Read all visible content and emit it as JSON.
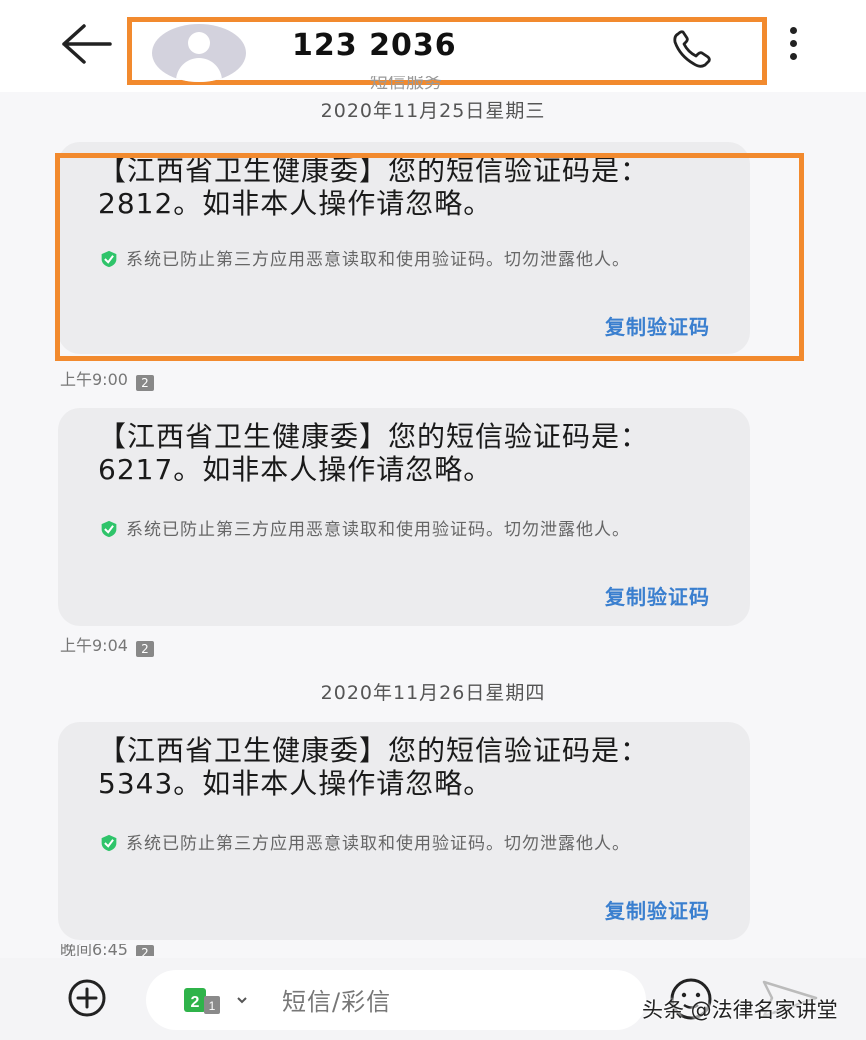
{
  "header": {
    "contact_name": "123 2036",
    "subtitle_fragment": "短信服务"
  },
  "messages": [
    {
      "date_separator": "2020年11月25日星期三",
      "text": "【江西省卫生健康委】您的短信验证码是：2812。如非本人操作请忽略。",
      "security_note": "系统已防止第三方应用恶意读取和使用验证码。切勿泄露他人。",
      "copy_label": "复制验证码",
      "time": "上午9:00",
      "sim": "2"
    },
    {
      "text": "【江西省卫生健康委】您的短信验证码是：6217。如非本人操作请忽略。",
      "security_note": "系统已防止第三方应用恶意读取和使用验证码。切勿泄露他人。",
      "copy_label": "复制验证码",
      "time": "上午9:04",
      "sim": "2"
    },
    {
      "date_separator": "2020年11月26日星期四",
      "text": "【江西省卫生健康委】您的短信验证码是：5343。如非本人操作请忽略。",
      "security_note": "系统已防止第三方应用恶意读取和使用验证码。切勿泄露他人。",
      "copy_label": "复制验证码",
      "time": "晚间6:45",
      "sim": "2"
    }
  ],
  "composer": {
    "sim_label": "2",
    "placeholder": "短信/彩信"
  },
  "watermark": "头条 @法律名家讲堂",
  "colors": {
    "highlight": "#f28a2e",
    "copy_link": "#3a7fcf",
    "shield": "#2fc46a",
    "sim_green": "#2fb34a"
  },
  "icons": [
    "back-arrow-icon",
    "avatar-icon",
    "phone-icon",
    "more-vert-icon",
    "shield-check-icon",
    "sim-card-icon",
    "add-circle-icon",
    "emoji-icon",
    "send-icon"
  ]
}
